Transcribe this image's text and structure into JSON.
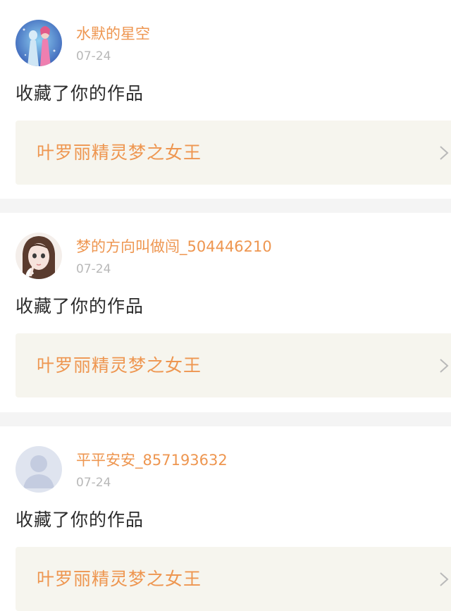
{
  "notifications": [
    {
      "username": "水默的星空",
      "time": "07-24",
      "action": "收藏了你的作品",
      "work_title": "叶罗丽精灵梦之女王",
      "avatar_icon": "fairy-avatar-icon"
    },
    {
      "username": "梦的方向叫做闯_504446210",
      "time": "07-24",
      "action": "收藏了你的作品",
      "work_title": "叶罗丽精灵梦之女王",
      "avatar_icon": "doll-avatar-icon"
    },
    {
      "username": "平平安安_857193632",
      "time": "07-24",
      "action": "收藏了你的作品",
      "work_title": "叶罗丽精灵梦之女王",
      "avatar_icon": "default-avatar-icon"
    }
  ],
  "colors": {
    "accent": "#ee9650",
    "card_bg": "#f6f5ee",
    "divider": "#f4f4f4",
    "time": "#b8b8b8",
    "text": "#2b2b2b"
  }
}
